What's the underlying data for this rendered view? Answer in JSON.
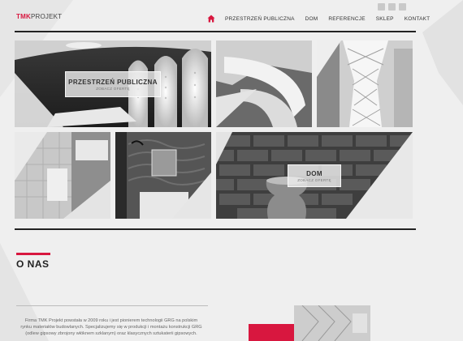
{
  "brand": {
    "part1": "TMK",
    "part2": "PROJEKT"
  },
  "nav": {
    "home_icon": "home-icon",
    "items": [
      "PRZESTRZEŃ PUBLICZNA",
      "DOM",
      "REFERENCJE",
      "SKLEP",
      "KONTAKT"
    ]
  },
  "social": [
    "square-icon",
    "square-icon",
    "square-icon"
  ],
  "tiles": {
    "public": {
      "title": "PRZESTRZEŃ PUBLICZNA",
      "subtitle": "ZOBACZ OFERTĘ"
    },
    "home": {
      "title": "DOM",
      "subtitle": "ZOBACZ OFERTĘ"
    }
  },
  "about": {
    "heading": "O NAS",
    "text": "Firma TMK Projekt powstała w 2009 roku i jest pionierem technologii GRG na polskim rynku materiałów budowlanych. Specjalizujemy się w produkcji i montażu konstrukcji GRG (odlew gipsowy zbrojony włóknem szklanym) oraz klasycznych sztukaterii gipsowych."
  },
  "colors": {
    "accent": "#d8173f",
    "rule": "#222222",
    "background": "#efefef"
  }
}
